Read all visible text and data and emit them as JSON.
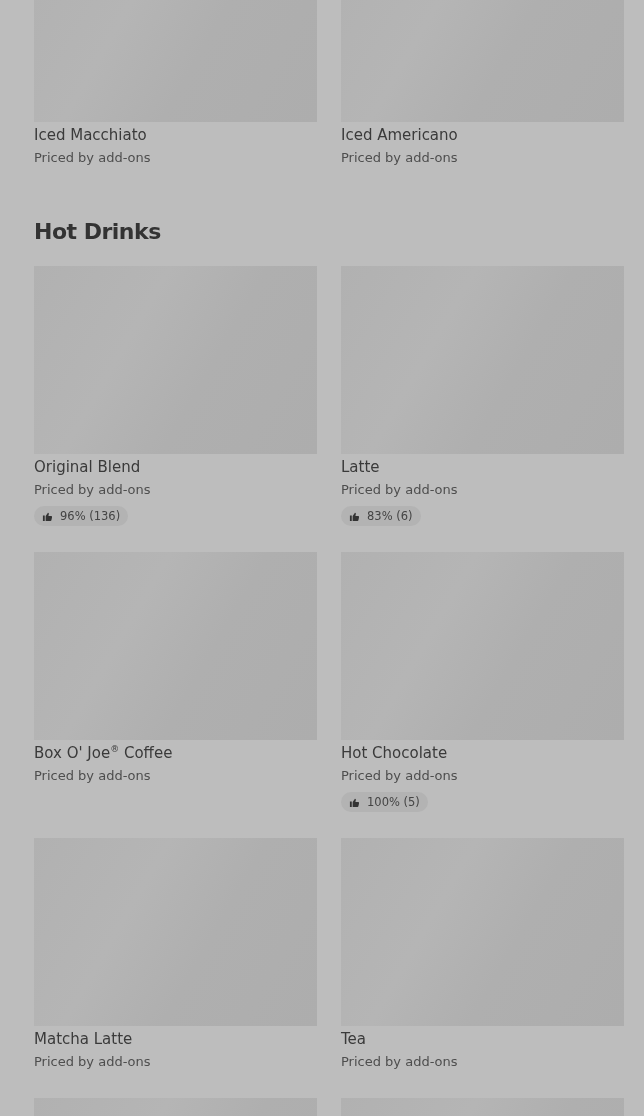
{
  "sections": [
    {
      "items": [
        {
          "name": "Iced Macchiato",
          "price": "Priced by add-ons"
        },
        {
          "name": "Iced Americano",
          "price": "Priced by add-ons"
        }
      ]
    },
    {
      "title": "Hot Drinks",
      "items": [
        {
          "name": "Original Blend",
          "price": "Priced by add-ons",
          "rating": "96% (136)"
        },
        {
          "name": "Latte",
          "price": "Priced by add-ons",
          "rating": "83% (6)"
        },
        {
          "name": "Box O' Joe$^{®}$ Coffee",
          "price": "Priced by add-ons"
        },
        {
          "name": "Hot Chocolate",
          "price": "Priced by add-ons",
          "rating": "100% (5)"
        },
        {
          "name": "Matcha Latte",
          "price": "Priced by add-ons"
        },
        {
          "name": "Tea",
          "price": "Priced by add-ons"
        },
        {
          "kind": "picture"
        },
        {
          "kind": "picture"
        }
      ]
    }
  ]
}
